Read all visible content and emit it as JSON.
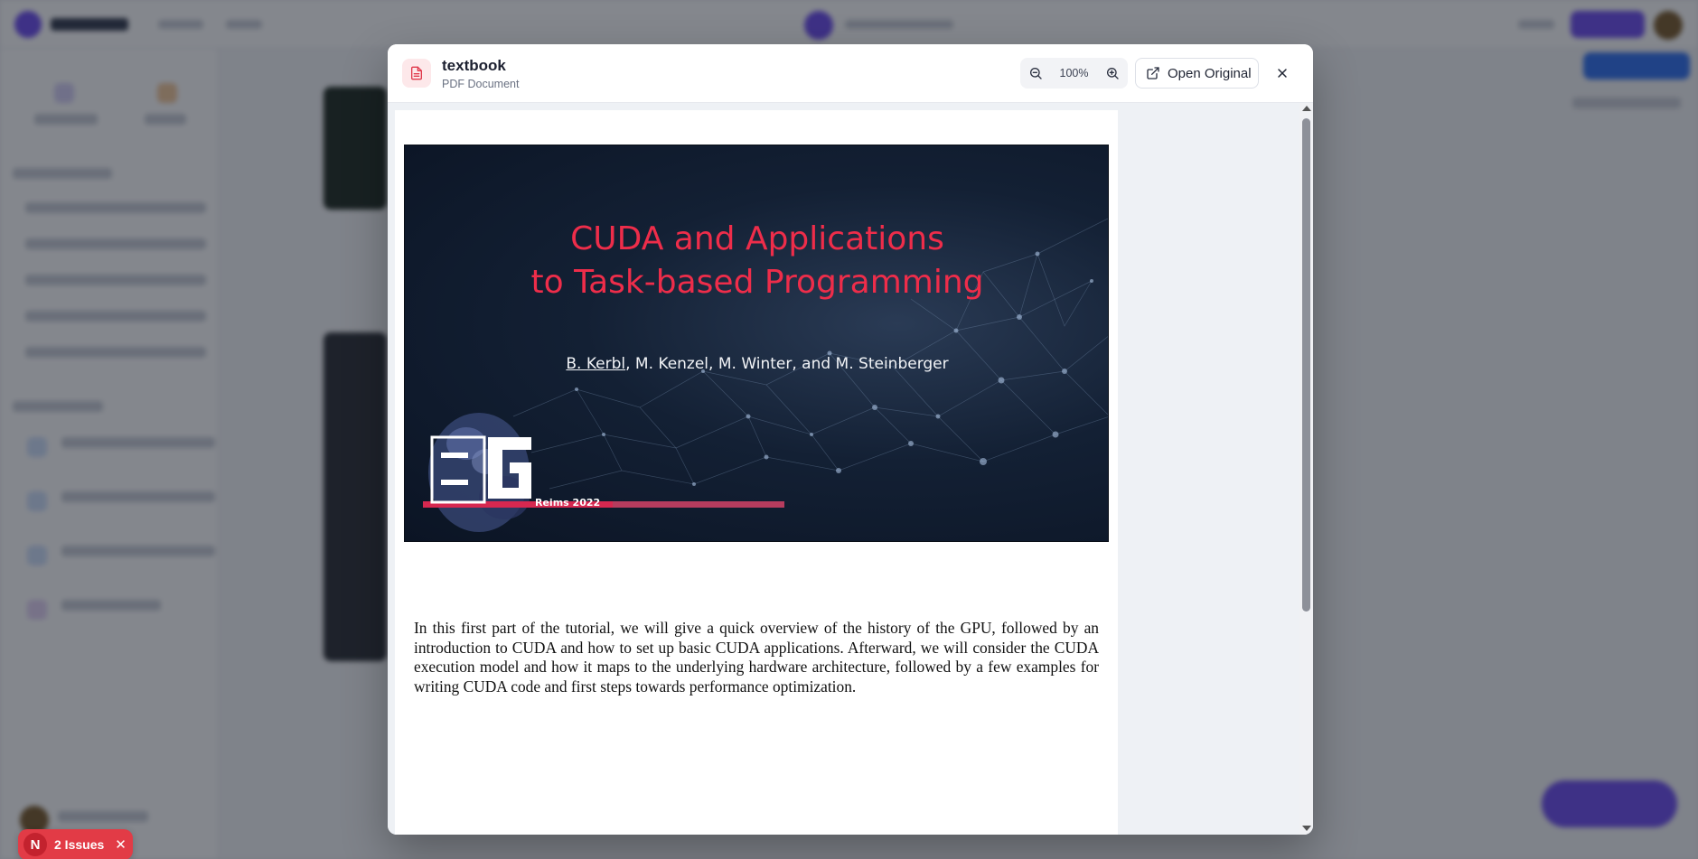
{
  "colors": {
    "accent": "#6d4cf0",
    "slide_title": "#ee2d4a",
    "issues_badge": "#e23b46",
    "pdf_icon": "#e0384b"
  },
  "modal": {
    "title": "textbook",
    "subtitle": "PDF Document",
    "file_icon": "pdf-file-icon",
    "zoom": {
      "level": "100%",
      "zoom_out_icon": "zoom-out-icon",
      "zoom_in_icon": "zoom-in-icon"
    },
    "open_original_label": "Open Original",
    "open_original_icon": "external-link-icon",
    "close_icon": "close-icon"
  },
  "document": {
    "slide": {
      "title_line1": "CUDA and Applications",
      "title_line2": "to Task-based Programming",
      "first_author": "B. Kerbl",
      "other_authors": ", M. Kenzel, M. Winter, and M. Steinberger",
      "event": "Reims 2022",
      "logo": "EG"
    },
    "paragraph": "In this first part of the tutorial, we will give a quick overview of the history of the GPU, followed by an introduction to CUDA and how to set up basic CUDA applications. Afterward, we will consider the CUDA execution model and how it maps to the underlying hardware architecture, followed by a few examples for writing CUDA code and first steps towards performance optimization."
  },
  "issues_badge": {
    "initial": "N",
    "label": "2 Issues",
    "close_icon": "close-icon"
  }
}
